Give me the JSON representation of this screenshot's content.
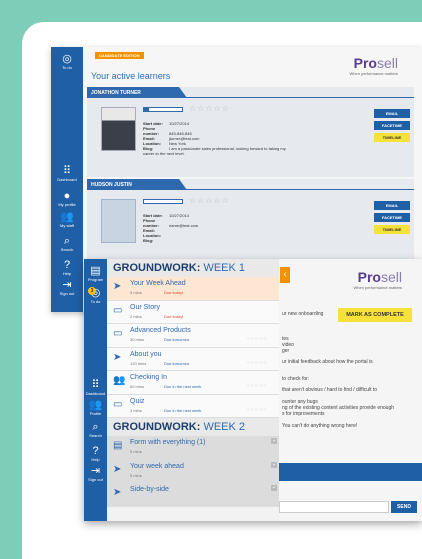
{
  "back": {
    "edition": "CANDIDATE EDITION",
    "brand": {
      "name_bold": "Pro",
      "name_light": "sell",
      "tagline": "When performance matters"
    },
    "title": "Your active learners",
    "sidebar": [
      {
        "label": "To do",
        "icon": "todo-icon"
      },
      {
        "label": "Dashboard",
        "icon": "grid-icon"
      },
      {
        "label": "My profile",
        "icon": "person-icon"
      },
      {
        "label": "My staff",
        "icon": "people-icon"
      },
      {
        "label": "Search",
        "icon": "search-icon"
      },
      {
        "label": "Help",
        "icon": "help-icon"
      },
      {
        "label": "Sign out",
        "icon": "signout-icon"
      }
    ],
    "learners": [
      {
        "name": "JONATHON TURNER",
        "progress": 0.12,
        "rating": 0,
        "stars": "☆☆☆☆☆",
        "fields": [
          {
            "k": "Start date:",
            "v": "10/27/2014"
          },
          {
            "k": "Phone number:",
            "v": "845-846-846"
          },
          {
            "k": "Email:",
            "v": "jturner@test.com"
          },
          {
            "k": "Location:",
            "v": "New York"
          },
          {
            "k": "Blog:",
            "v": "I am a passionate sales professional, looking forward to taking my career to the next level."
          }
        ],
        "buttons": [
          "EMAIL",
          "FACETIME",
          "TIMELINE"
        ]
      },
      {
        "name": "HUDSON JUSTIN",
        "progress": 0.0,
        "rating": 0,
        "stars": "☆☆☆☆☆",
        "fields": [
          {
            "k": "Start date:",
            "v": "10/27/2014"
          },
          {
            "k": "Phone number:",
            "v": "name@test.com"
          },
          {
            "k": "Email:",
            "v": ""
          },
          {
            "k": "Location:",
            "v": ""
          },
          {
            "k": "Blog:",
            "v": ""
          }
        ],
        "buttons": [
          "EMAIL",
          "FACETIME",
          "TIMELINE"
        ]
      }
    ]
  },
  "front": {
    "sidebar": [
      {
        "label": "Program",
        "icon": "program-icon"
      },
      {
        "label": "To do",
        "icon": "todo-icon",
        "badge": "3"
      },
      {
        "label": "Dashboard",
        "icon": "grid-icon"
      },
      {
        "label": "Profile",
        "icon": "people-icon"
      },
      {
        "label": "Search",
        "icon": "search-icon"
      },
      {
        "label": "Help",
        "icon": "help-icon"
      },
      {
        "label": "Sign out",
        "icon": "signout-icon"
      }
    ],
    "sections": [
      {
        "title_bold": "GROUNDWORK:",
        "title_light": "WEEK 1",
        "items": [
          {
            "icon": "arrow-icon",
            "title": "Your Week Ahead",
            "meta": "5 mins",
            "due": "Due today!",
            "due_color": "#e0482a",
            "state": "active"
          },
          {
            "icon": "screen-icon",
            "title": "Our Story",
            "meta": "2 mins",
            "due": "Due today!",
            "due_color": "#e0482a",
            "state": "normal"
          },
          {
            "icon": "screen-icon",
            "title": "Advanced Products",
            "meta": "30 mins",
            "due": "Due tomorrow",
            "due_color": "#2e69b0",
            "state": "normal",
            "dots": "○○○○○"
          },
          {
            "icon": "arrow-icon",
            "title": "About you",
            "meta": "120 mins",
            "due": "Due tomorrow",
            "due_color": "#2e69b0",
            "state": "normal",
            "dots": "○○○○○"
          },
          {
            "icon": "people-icon",
            "title": "Checking In",
            "meta": "60 mins",
            "due": "Due in the next week",
            "due_color": "#2e69b0",
            "state": "normal",
            "dots": "○○○○○"
          },
          {
            "icon": "screen-icon",
            "title": "Quiz",
            "meta": "3 mins",
            "due": "Due in the next week",
            "due_color": "#2e69b0",
            "state": "normal",
            "dots": "○○○○○"
          }
        ]
      },
      {
        "title_bold": "GROUNDWORK:",
        "title_light": "WEEK 2",
        "items": [
          {
            "icon": "doc-icon",
            "title": "Form with everything (1)",
            "meta": "5 mins",
            "state": "dark"
          },
          {
            "icon": "arrow-icon",
            "title": "Your week ahead",
            "meta": "5 mins",
            "state": "dark"
          },
          {
            "icon": "arrow-icon",
            "title": "Side-by-side",
            "meta": "",
            "state": "dark"
          }
        ]
      }
    ],
    "right": {
      "brand": {
        "name_bold": "Pro",
        "name_light": "sell",
        "tagline": "When performance matters"
      },
      "lines": [
        "ur new onboarding",
        "tes",
        "video",
        "ger",
        "ur initial feedback about how the portal is",
        "to check for:",
        "that aren't obvious / hard to find / difficult to",
        "ounter any bugs",
        "ng of the existing content activities provide enough",
        "s for improvements",
        "You can't do anything wrong here!"
      ],
      "mark_complete": "MARK AS COMPLETE",
      "send": "SEND"
    }
  }
}
